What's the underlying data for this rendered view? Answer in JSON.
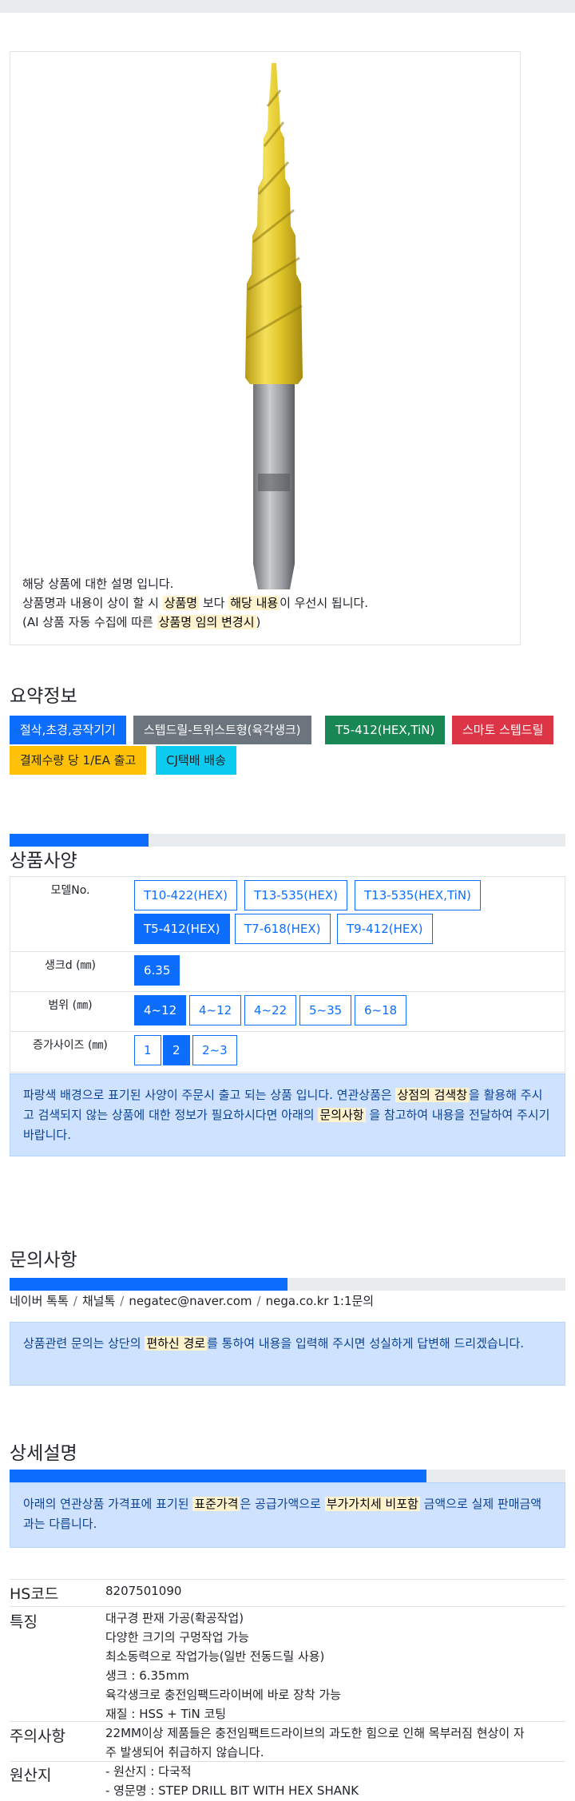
{
  "image_description": {
    "line1": "해당 상품에 대한 설명 입니다.",
    "line2_prefix": "상품명과 내용이 상이 할 시 ",
    "line2_mark1": "상품명",
    "line2_mid": " 보다 ",
    "line2_mark2": "해당 내용",
    "line2_suffix": "이 우선시 됩니다.",
    "line3_prefix": "(AI 상품 자동 수집에 따른 ",
    "line3_mark": "상품명 임의 변경시",
    "line3_suffix": ")"
  },
  "summary": {
    "title": "요약정보",
    "badges": [
      "절삭,초경,공작기기",
      "스텝드릴-트위스트형(육각생크)",
      "T5-412(HEX,TiN)",
      "스마토 스텝드릴",
      "결제수량 당 1/EA 출고",
      "CJ택배 배송"
    ]
  },
  "spec": {
    "title": "상품사양",
    "progress": 0.25,
    "rows": [
      {
        "label": "모델No.",
        "options": [
          "T10-422(HEX)",
          "T13-535(HEX)",
          "T13-535(HEX,TiN)",
          "T5-412(HEX)",
          "T7-618(HEX)",
          "T9-412(HEX)"
        ],
        "active": 3
      },
      {
        "label": "생크d (㎜)",
        "options": [
          "6.35"
        ],
        "active": 0
      },
      {
        "label": "범위 (㎜)",
        "options": [
          "4~12",
          "4~12",
          "4~22",
          "5~35",
          "6~18"
        ],
        "active": 0
      },
      {
        "label": "증가사이즈 (㎜)",
        "options": [
          "1",
          "2",
          "2~3"
        ],
        "active": 1
      }
    ],
    "notice": {
      "prefix": "파랑색 배경으로 표기된 사양이 주문시 출고 되는 상품 입니다. 연관상품은 ",
      "mark1": "상점의 검색창",
      "mid": "을 활용해 주시고 검색되지 않는 상품에 대한 정보가 필요하시다면 아래의 ",
      "mark2": "문의사항",
      "suffix": " 을 참고하여 내용을 전달하여 주시기 바랍니다."
    }
  },
  "inquiry": {
    "title": "문의사항",
    "progress": 0.5,
    "links": [
      "네이버 톡톡",
      "채널톡",
      "negatec@naver.com",
      "nega.co.kr 1:1문의"
    ],
    "notice": {
      "prefix": "상품관련 문의는 상단의 ",
      "mark": "편하신 경로",
      "suffix": "를 통하여 내용을 입력해 주시면 성실하게 답변해 드리겠습니다."
    }
  },
  "detail": {
    "title": "상세설명",
    "progress": 0.75,
    "notice": {
      "prefix": "아래의 연관상품 가격표에 표기된 ",
      "mark1": "표준가격",
      "mid": "은 공급가액으로 ",
      "mark2": "부가가치세 비포함",
      "suffix": " 금액으로 실제 판매금액과는 다릅니다."
    },
    "hs_label": "HS코드",
    "hs_value": "8207501090",
    "feature_label": "특징",
    "features": [
      "대구경 판재 가공(확공작업)",
      "다양한 크기의 구멍작업 가능",
      "최소동력으로 작업가능(일반 전동드릴 사용)",
      "생크 : 6.35mm",
      "육각생크로 충전임팩드라이버에 바로 장착 가능",
      "재질 : HSS + TiN 코팅"
    ],
    "caution_label": "주의사항",
    "caution_lines": [
      "22MM이상 제품들은 충전임팩트드라이브의 과도한 힘으로 인해 목부러짐 현상이 자",
      "주 발생되어 취급하지 않습니다."
    ],
    "origin_label": "원산지",
    "origin_lines": [
      "- 원산지 : 다국적",
      "- 영문명 : STEP DRILL BIT WITH HEX SHANK"
    ]
  },
  "colors": {
    "primary": "#0d6efd",
    "highlight": "#fff3cd",
    "alert_bg": "#cfe2ff"
  }
}
